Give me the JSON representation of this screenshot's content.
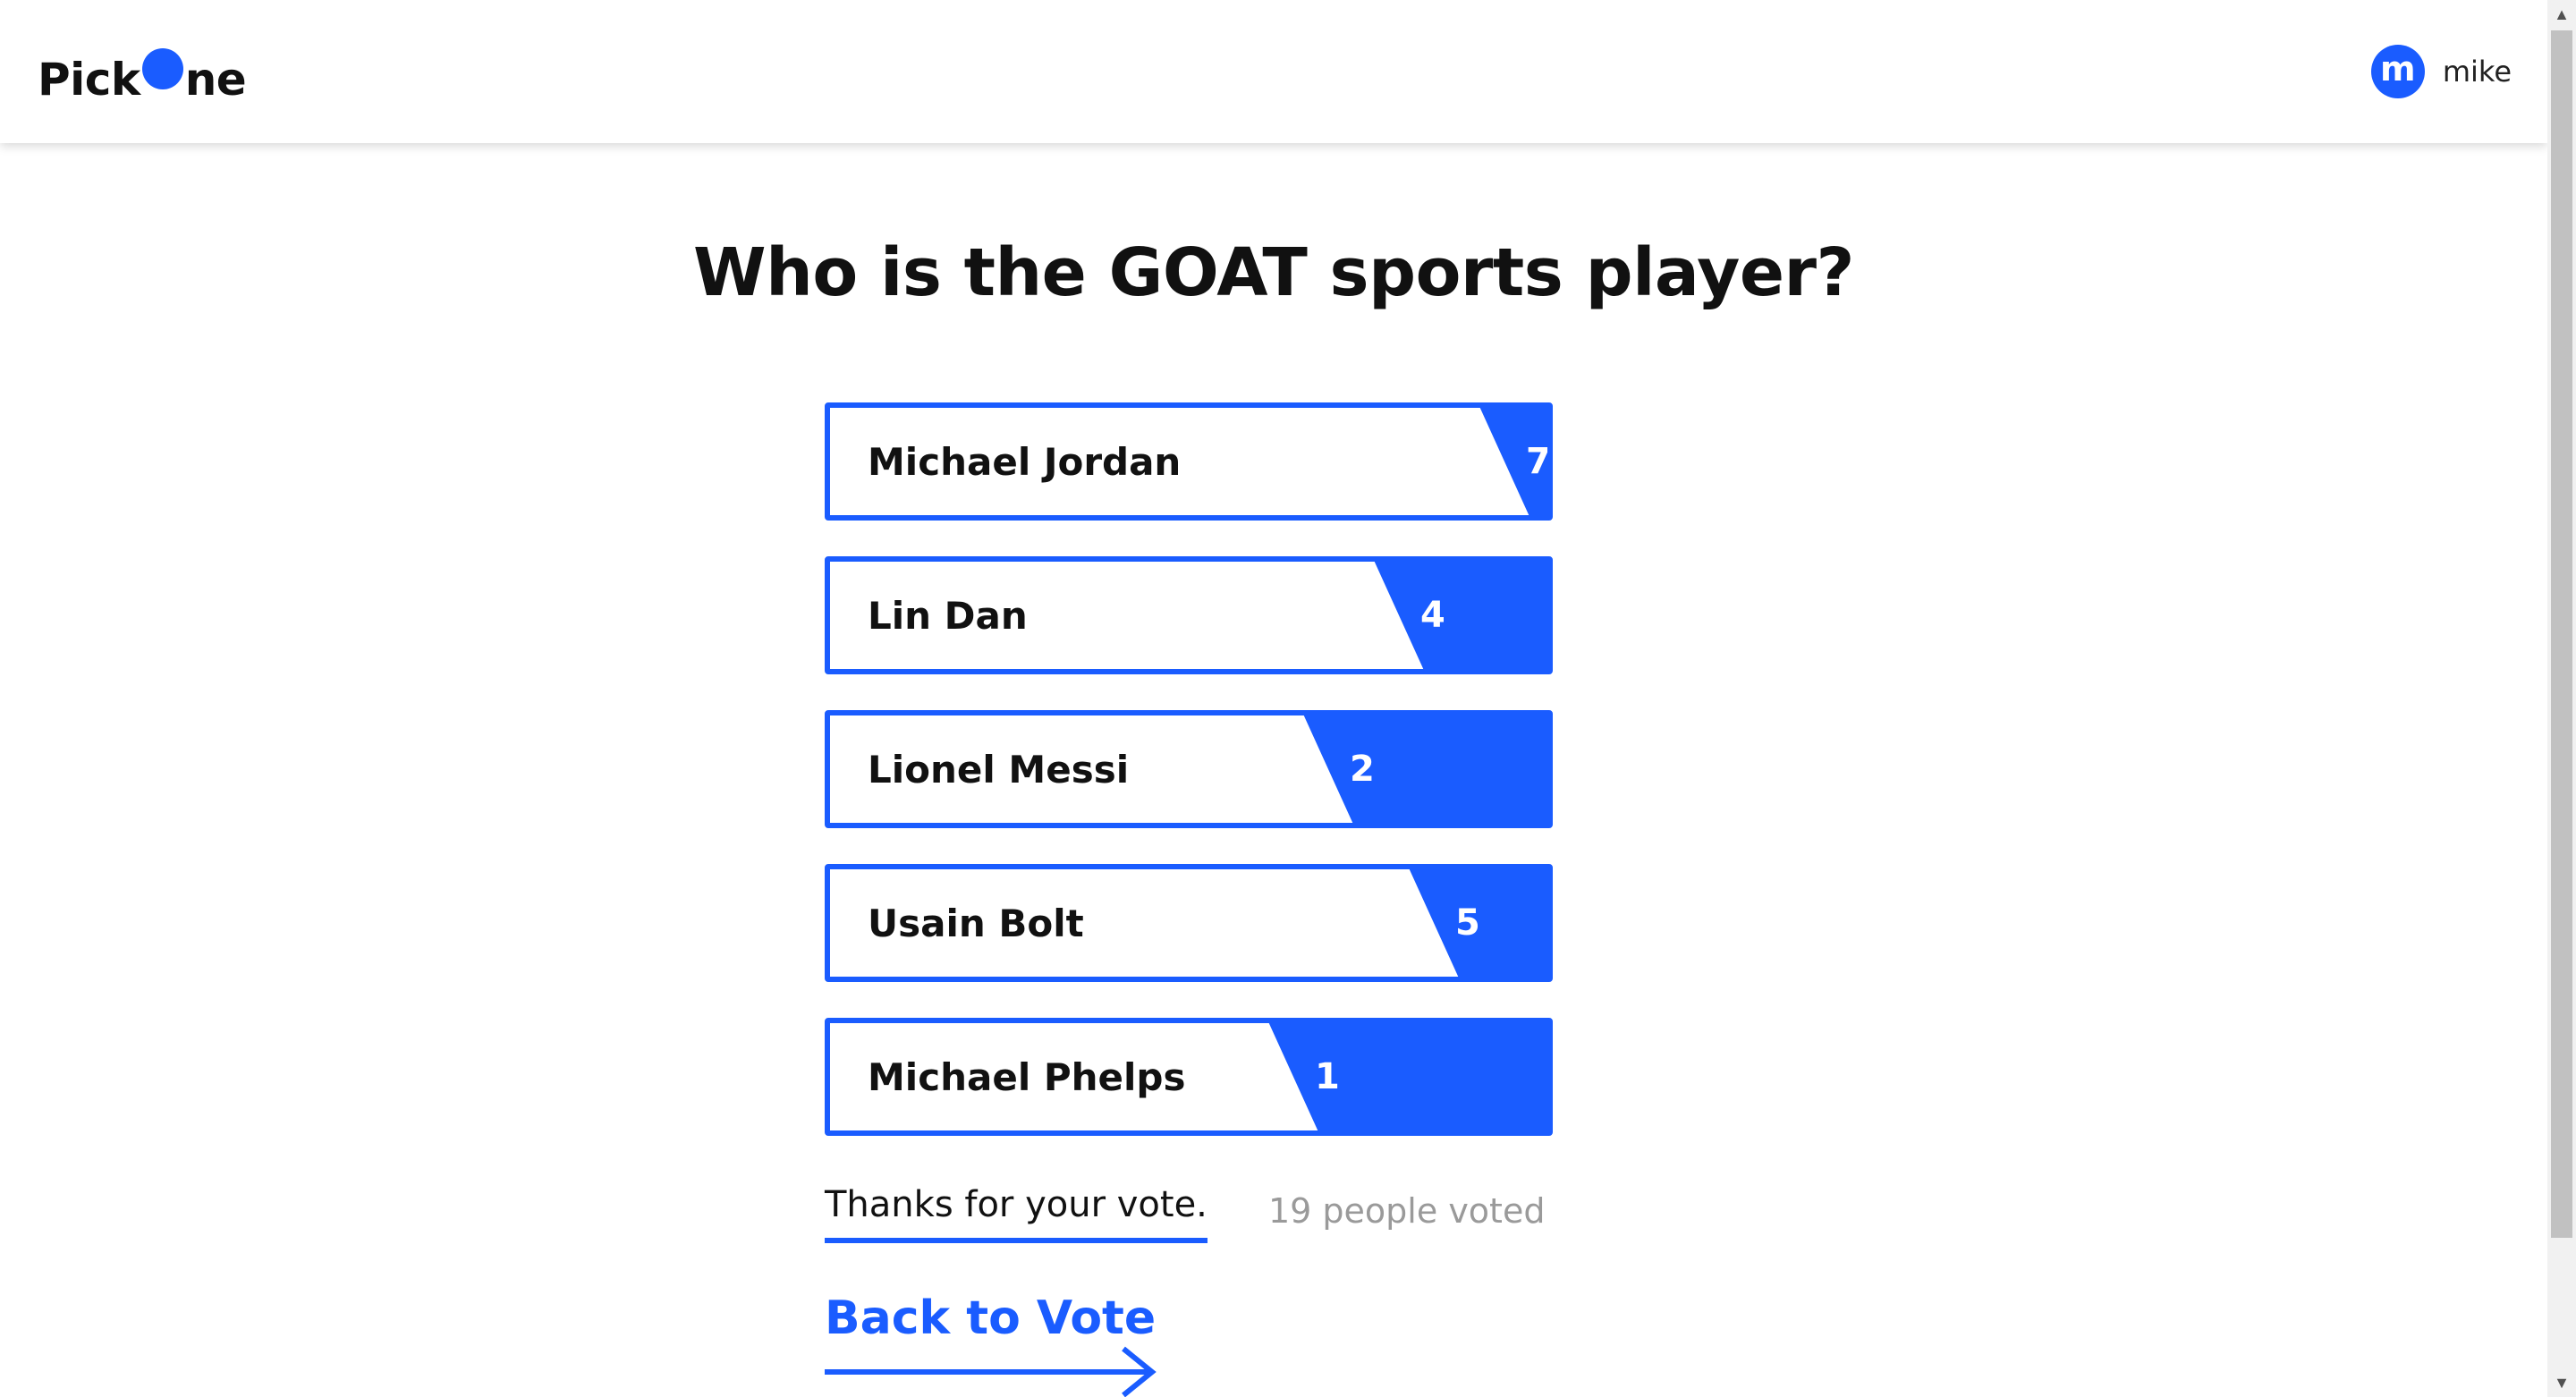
{
  "header": {
    "logo_left": "Pick",
    "logo_right": "ne",
    "user": {
      "avatar_letter": "m",
      "name": "mike"
    }
  },
  "poll": {
    "question": "Who is the GOAT sports player?",
    "max_votes": 7,
    "options": [
      {
        "name": "Michael Jordan",
        "votes": 7
      },
      {
        "name": "Lin Dan",
        "votes": 4
      },
      {
        "name": "Lionel Messi",
        "votes": 2
      },
      {
        "name": "Usain Bolt",
        "votes": 5
      },
      {
        "name": "Michael Phelps",
        "votes": 1
      }
    ],
    "thanks_text": "Thanks for your vote.",
    "voted_text": "19 people voted",
    "back_label": "Back to Vote"
  },
  "colors": {
    "accent": "#1a5cff",
    "text": "#111111",
    "muted": "#9a9a9a"
  },
  "icons": {
    "arrow": "right-arrow-icon",
    "scroll_up": "triangle-up-icon",
    "scroll_down": "triangle-down-icon"
  }
}
